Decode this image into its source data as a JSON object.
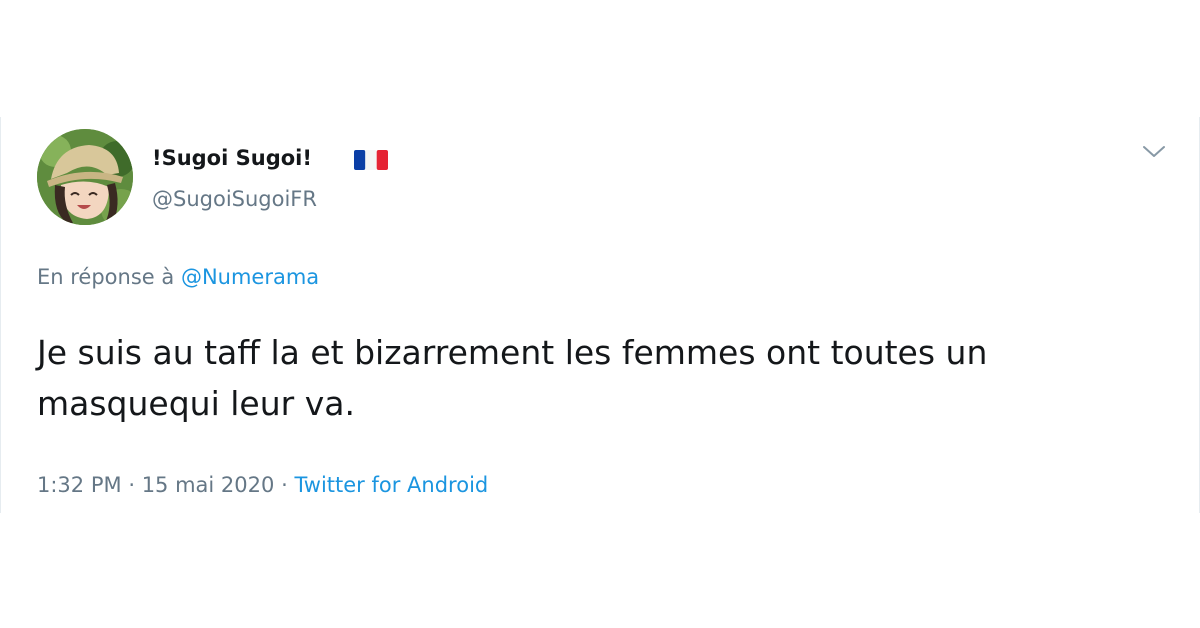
{
  "tweet": {
    "author": {
      "display_name": "!Sugoi Sugoi!",
      "flag": "French flag",
      "handle": "@SugoiSugoiFR"
    },
    "reply": {
      "prefix": "En réponse à",
      "mention": "@Numerama"
    },
    "text": "Je suis au taff la et bizarrement les femmes ont toutes un masquequi leur va.",
    "meta": {
      "time": "1:32 PM",
      "separator": "·",
      "date": "15 mai 2020",
      "source": "Twitter for Android"
    },
    "menu_icon": "chevron-down-icon"
  },
  "colors": {
    "text_primary": "#14171a",
    "text_secondary": "#657786",
    "link": "#1b95e0",
    "border": "#e6ecf0"
  }
}
